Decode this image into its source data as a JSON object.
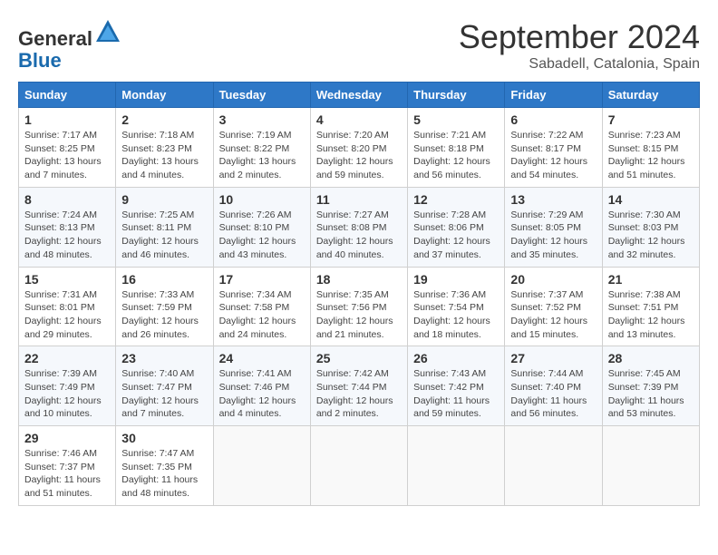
{
  "header": {
    "logo_general": "General",
    "logo_blue": "Blue",
    "month_title": "September 2024",
    "location": "Sabadell, Catalonia, Spain"
  },
  "weekdays": [
    "Sunday",
    "Monday",
    "Tuesday",
    "Wednesday",
    "Thursday",
    "Friday",
    "Saturday"
  ],
  "weeks": [
    [
      {
        "day": "1",
        "info": "Sunrise: 7:17 AM\nSunset: 8:25 PM\nDaylight: 13 hours\nand 7 minutes."
      },
      {
        "day": "2",
        "info": "Sunrise: 7:18 AM\nSunset: 8:23 PM\nDaylight: 13 hours\nand 4 minutes."
      },
      {
        "day": "3",
        "info": "Sunrise: 7:19 AM\nSunset: 8:22 PM\nDaylight: 13 hours\nand 2 minutes."
      },
      {
        "day": "4",
        "info": "Sunrise: 7:20 AM\nSunset: 8:20 PM\nDaylight: 12 hours\nand 59 minutes."
      },
      {
        "day": "5",
        "info": "Sunrise: 7:21 AM\nSunset: 8:18 PM\nDaylight: 12 hours\nand 56 minutes."
      },
      {
        "day": "6",
        "info": "Sunrise: 7:22 AM\nSunset: 8:17 PM\nDaylight: 12 hours\nand 54 minutes."
      },
      {
        "day": "7",
        "info": "Sunrise: 7:23 AM\nSunset: 8:15 PM\nDaylight: 12 hours\nand 51 minutes."
      }
    ],
    [
      {
        "day": "8",
        "info": "Sunrise: 7:24 AM\nSunset: 8:13 PM\nDaylight: 12 hours\nand 48 minutes."
      },
      {
        "day": "9",
        "info": "Sunrise: 7:25 AM\nSunset: 8:11 PM\nDaylight: 12 hours\nand 46 minutes."
      },
      {
        "day": "10",
        "info": "Sunrise: 7:26 AM\nSunset: 8:10 PM\nDaylight: 12 hours\nand 43 minutes."
      },
      {
        "day": "11",
        "info": "Sunrise: 7:27 AM\nSunset: 8:08 PM\nDaylight: 12 hours\nand 40 minutes."
      },
      {
        "day": "12",
        "info": "Sunrise: 7:28 AM\nSunset: 8:06 PM\nDaylight: 12 hours\nand 37 minutes."
      },
      {
        "day": "13",
        "info": "Sunrise: 7:29 AM\nSunset: 8:05 PM\nDaylight: 12 hours\nand 35 minutes."
      },
      {
        "day": "14",
        "info": "Sunrise: 7:30 AM\nSunset: 8:03 PM\nDaylight: 12 hours\nand 32 minutes."
      }
    ],
    [
      {
        "day": "15",
        "info": "Sunrise: 7:31 AM\nSunset: 8:01 PM\nDaylight: 12 hours\nand 29 minutes."
      },
      {
        "day": "16",
        "info": "Sunrise: 7:33 AM\nSunset: 7:59 PM\nDaylight: 12 hours\nand 26 minutes."
      },
      {
        "day": "17",
        "info": "Sunrise: 7:34 AM\nSunset: 7:58 PM\nDaylight: 12 hours\nand 24 minutes."
      },
      {
        "day": "18",
        "info": "Sunrise: 7:35 AM\nSunset: 7:56 PM\nDaylight: 12 hours\nand 21 minutes."
      },
      {
        "day": "19",
        "info": "Sunrise: 7:36 AM\nSunset: 7:54 PM\nDaylight: 12 hours\nand 18 minutes."
      },
      {
        "day": "20",
        "info": "Sunrise: 7:37 AM\nSunset: 7:52 PM\nDaylight: 12 hours\nand 15 minutes."
      },
      {
        "day": "21",
        "info": "Sunrise: 7:38 AM\nSunset: 7:51 PM\nDaylight: 12 hours\nand 13 minutes."
      }
    ],
    [
      {
        "day": "22",
        "info": "Sunrise: 7:39 AM\nSunset: 7:49 PM\nDaylight: 12 hours\nand 10 minutes."
      },
      {
        "day": "23",
        "info": "Sunrise: 7:40 AM\nSunset: 7:47 PM\nDaylight: 12 hours\nand 7 minutes."
      },
      {
        "day": "24",
        "info": "Sunrise: 7:41 AM\nSunset: 7:46 PM\nDaylight: 12 hours\nand 4 minutes."
      },
      {
        "day": "25",
        "info": "Sunrise: 7:42 AM\nSunset: 7:44 PM\nDaylight: 12 hours\nand 2 minutes."
      },
      {
        "day": "26",
        "info": "Sunrise: 7:43 AM\nSunset: 7:42 PM\nDaylight: 11 hours\nand 59 minutes."
      },
      {
        "day": "27",
        "info": "Sunrise: 7:44 AM\nSunset: 7:40 PM\nDaylight: 11 hours\nand 56 minutes."
      },
      {
        "day": "28",
        "info": "Sunrise: 7:45 AM\nSunset: 7:39 PM\nDaylight: 11 hours\nand 53 minutes."
      }
    ],
    [
      {
        "day": "29",
        "info": "Sunrise: 7:46 AM\nSunset: 7:37 PM\nDaylight: 11 hours\nand 51 minutes."
      },
      {
        "day": "30",
        "info": "Sunrise: 7:47 AM\nSunset: 7:35 PM\nDaylight: 11 hours\nand 48 minutes."
      },
      {
        "day": "",
        "info": ""
      },
      {
        "day": "",
        "info": ""
      },
      {
        "day": "",
        "info": ""
      },
      {
        "day": "",
        "info": ""
      },
      {
        "day": "",
        "info": ""
      }
    ]
  ]
}
